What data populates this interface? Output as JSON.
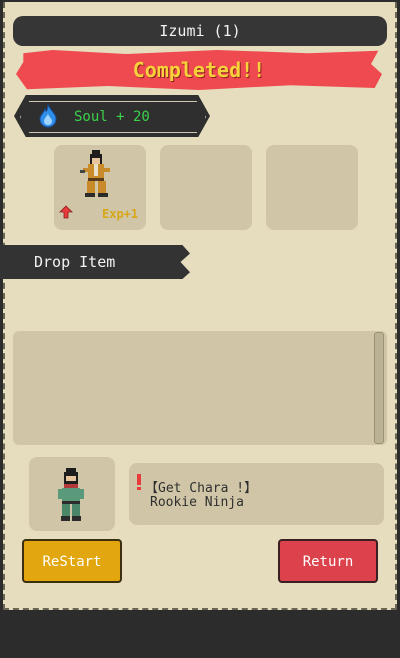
{
  "header": {
    "title": "Izumi (1)"
  },
  "result": {
    "status": "Completed!!"
  },
  "reward": {
    "soul_text": "Soul + 20",
    "icon": "blue-flame-icon"
  },
  "slots": [
    {
      "character": "brown-robed-ninja",
      "exp_text": "Exp+1",
      "badge": "red-up-arrow-icon"
    },
    {
      "character": ""
    },
    {
      "character": ""
    }
  ],
  "drop": {
    "label": "Drop Item"
  },
  "message": {
    "line1": "【Get Chara !】",
    "line2": "Rookie Ninja",
    "icon": "red-exclamation-icon",
    "character": "green-ninja"
  },
  "buttons": {
    "restart": "ReStart",
    "return": "Return"
  },
  "colors": {
    "panel": "#e6dcbe",
    "slot": "#d0c6a7",
    "completed_bg": "#ef4a4f",
    "completed_text": "#f7d23a",
    "soul_text": "#3ad24a",
    "restart_btn": "#e2a70e",
    "return_btn": "#dc424b"
  }
}
